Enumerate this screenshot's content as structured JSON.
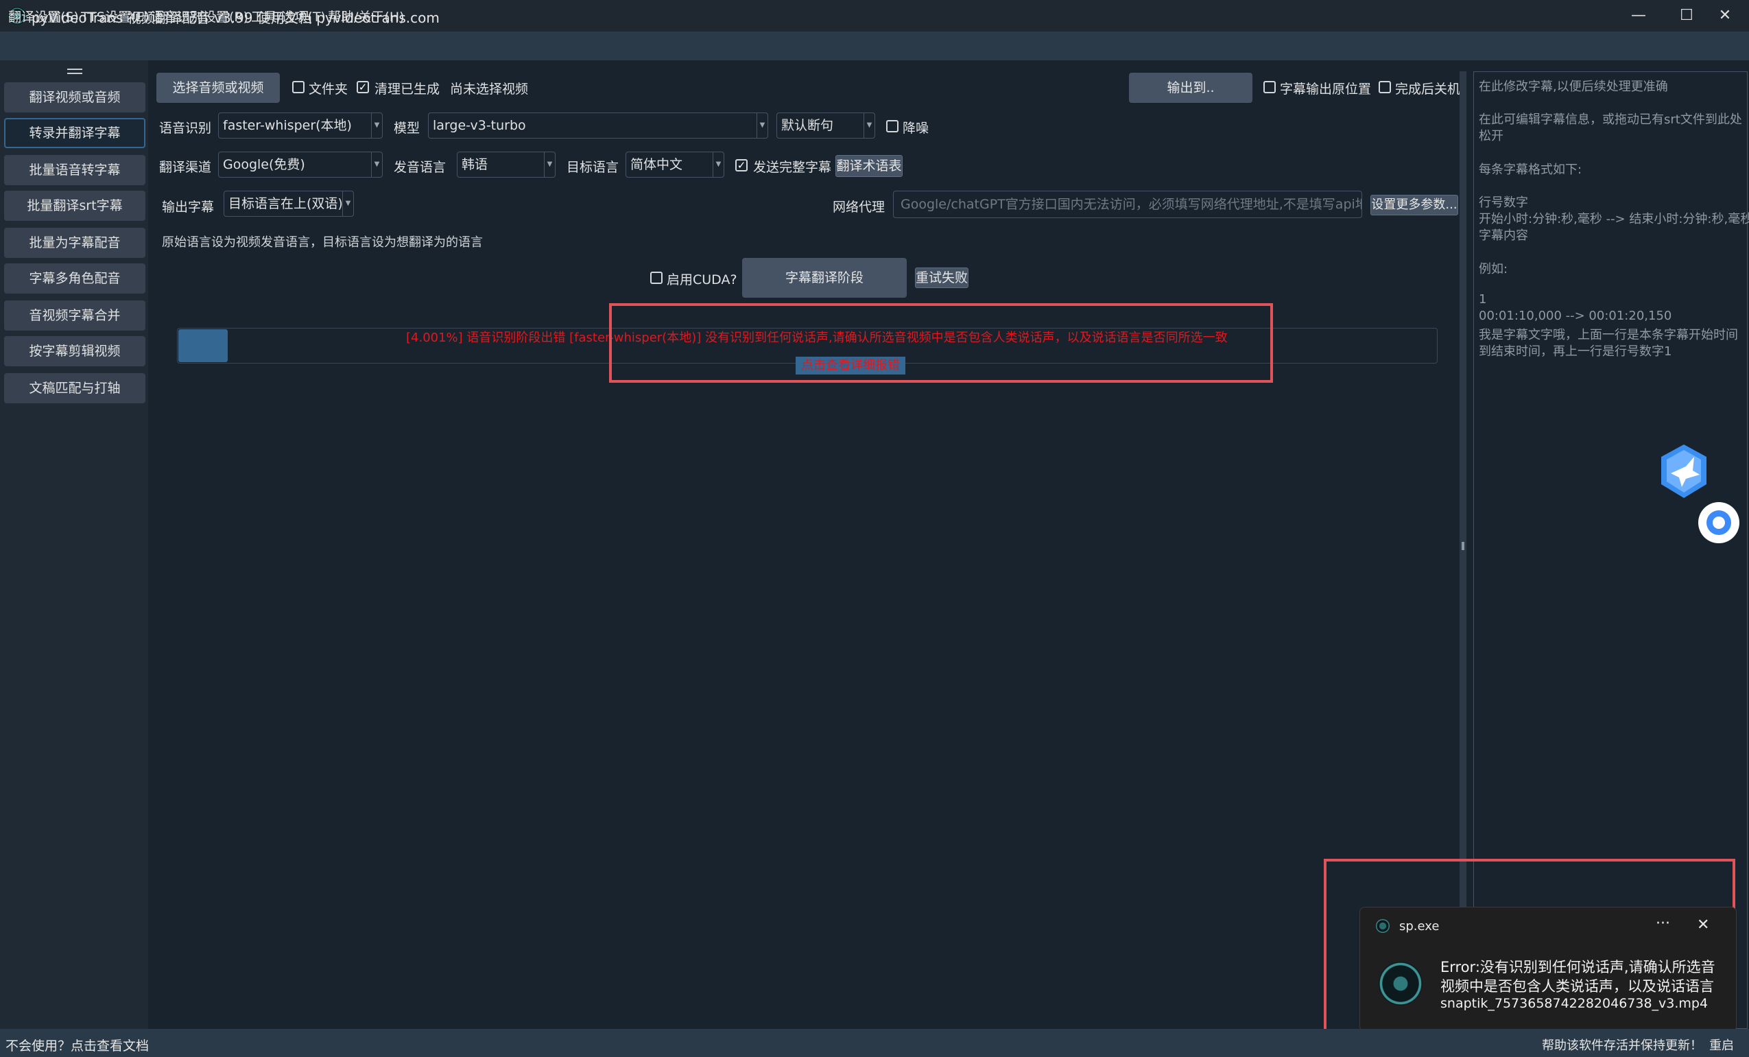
{
  "window": {
    "title": "pyVideoTrans 视频翻译配音 v3.99 使用文档 pyvideotrans.com",
    "minimize": "—",
    "maximize": "☐",
    "close": "✕"
  },
  "menu": [
    "翻译设置(S)",
    "TTS设置(E)",
    "语音识别设置(R)",
    "工具/选项(T)",
    "帮助/关于(H)"
  ],
  "sidebar": {
    "items": [
      {
        "label": "翻译视频或音频",
        "active": false
      },
      {
        "label": "转录并翻译字幕",
        "active": true
      },
      {
        "label": "批量语音转字幕",
        "active": false
      },
      {
        "label": "批量翻译srt字幕",
        "active": false
      },
      {
        "label": "批量为字幕配音",
        "active": false
      },
      {
        "label": "字幕多角色配音",
        "active": false
      },
      {
        "label": "音视频字幕合并",
        "active": false
      },
      {
        "label": "按字幕剪辑视频",
        "active": false
      },
      {
        "label": "文稿匹配与打轴",
        "active": false
      }
    ]
  },
  "toolbar": {
    "select_media": "选择音频或视频",
    "folder_label": "文件夹",
    "folder_checked": false,
    "clear_label": "清理已生成",
    "clear_checked": true,
    "no_video": "尚未选择视频",
    "output_to": "输出到..",
    "subtitle_orig_pos": "字幕输出原位置",
    "shutdown_after": "完成后关机"
  },
  "asr": {
    "label": "语音识别",
    "engine": "faster-whisper(本地)",
    "model_label": "模型",
    "model": "large-v3-turbo",
    "split": "默认断句",
    "denoise_label": "降噪",
    "denoise_checked": false
  },
  "translate": {
    "channel_label": "翻译渠道",
    "channel": "Google(免费)",
    "source_label": "发音语言",
    "source": "韩语",
    "target_label": "目标语言",
    "target": "简体中文",
    "send_full_label": "发送完整字幕",
    "send_full_checked": true,
    "glossary": "翻译术语表"
  },
  "output": {
    "label": "输出字幕",
    "mode": "目标语言在上(双语)",
    "proxy_label": "网络代理",
    "proxy_placeholder": "Google/chatGPT官方接口国内无法访问，必须填写网络代理地址,不是填写api地址",
    "more_params": "设置更多参数..."
  },
  "hint": "原始语言设为视频发音语言，目标语言设为想翻译为的语言",
  "actions": {
    "cuda_label": "启用CUDA?",
    "cuda_checked": false,
    "stage_button": "字幕翻译阶段",
    "retry_button": "重试失败"
  },
  "progress": {
    "percent": 4.001,
    "message": "[4.001%]  语音识别阶段出错 [faster-whisper(本地)] 没有识别到任何说话声,请确认所选音视频中是否包含人类说话声，以及说话语言是否同所选一致",
    "detail_link": "点击查看详细报错"
  },
  "right_panel": {
    "lines": [
      "在此修改字幕,以便后续处理更准确",
      "",
      " 在此可编辑字幕信息，或拖动已有srt文件到此处",
      "松开",
      "",
      "每条字幕格式如下:",
      "",
      "行号数字",
      "开始小时:分钟:秒,毫秒 --> 结束小时:分钟:秒,毫秒",
      "字幕内容",
      "",
      "例如:",
      "",
      "1",
      "00:01:10,000 --> 00:01:20,150",
      "我是字幕文字哦，上面一行是本条字幕开始时间",
      "到结束时间，再上一行是行号数字1"
    ]
  },
  "toast": {
    "app": "sp.exe",
    "more": "···",
    "close": "✕",
    "lines": [
      "Error:没有识别到任何说话声,请确认所选音",
      "视频中是否包含人类说话声，以及说话语言",
      "snaptik_7573658742282046738_v3.mp4"
    ]
  },
  "statusbar": {
    "left": "不会使用？点击查看文档",
    "right": "帮助该软件存活并保持更新！",
    "restart": "重启"
  },
  "colors": {
    "bg": "#19232d",
    "accent": "#346792",
    "button": "#455364",
    "error_text": "#e0181f",
    "highlight_box": "#e05358"
  }
}
